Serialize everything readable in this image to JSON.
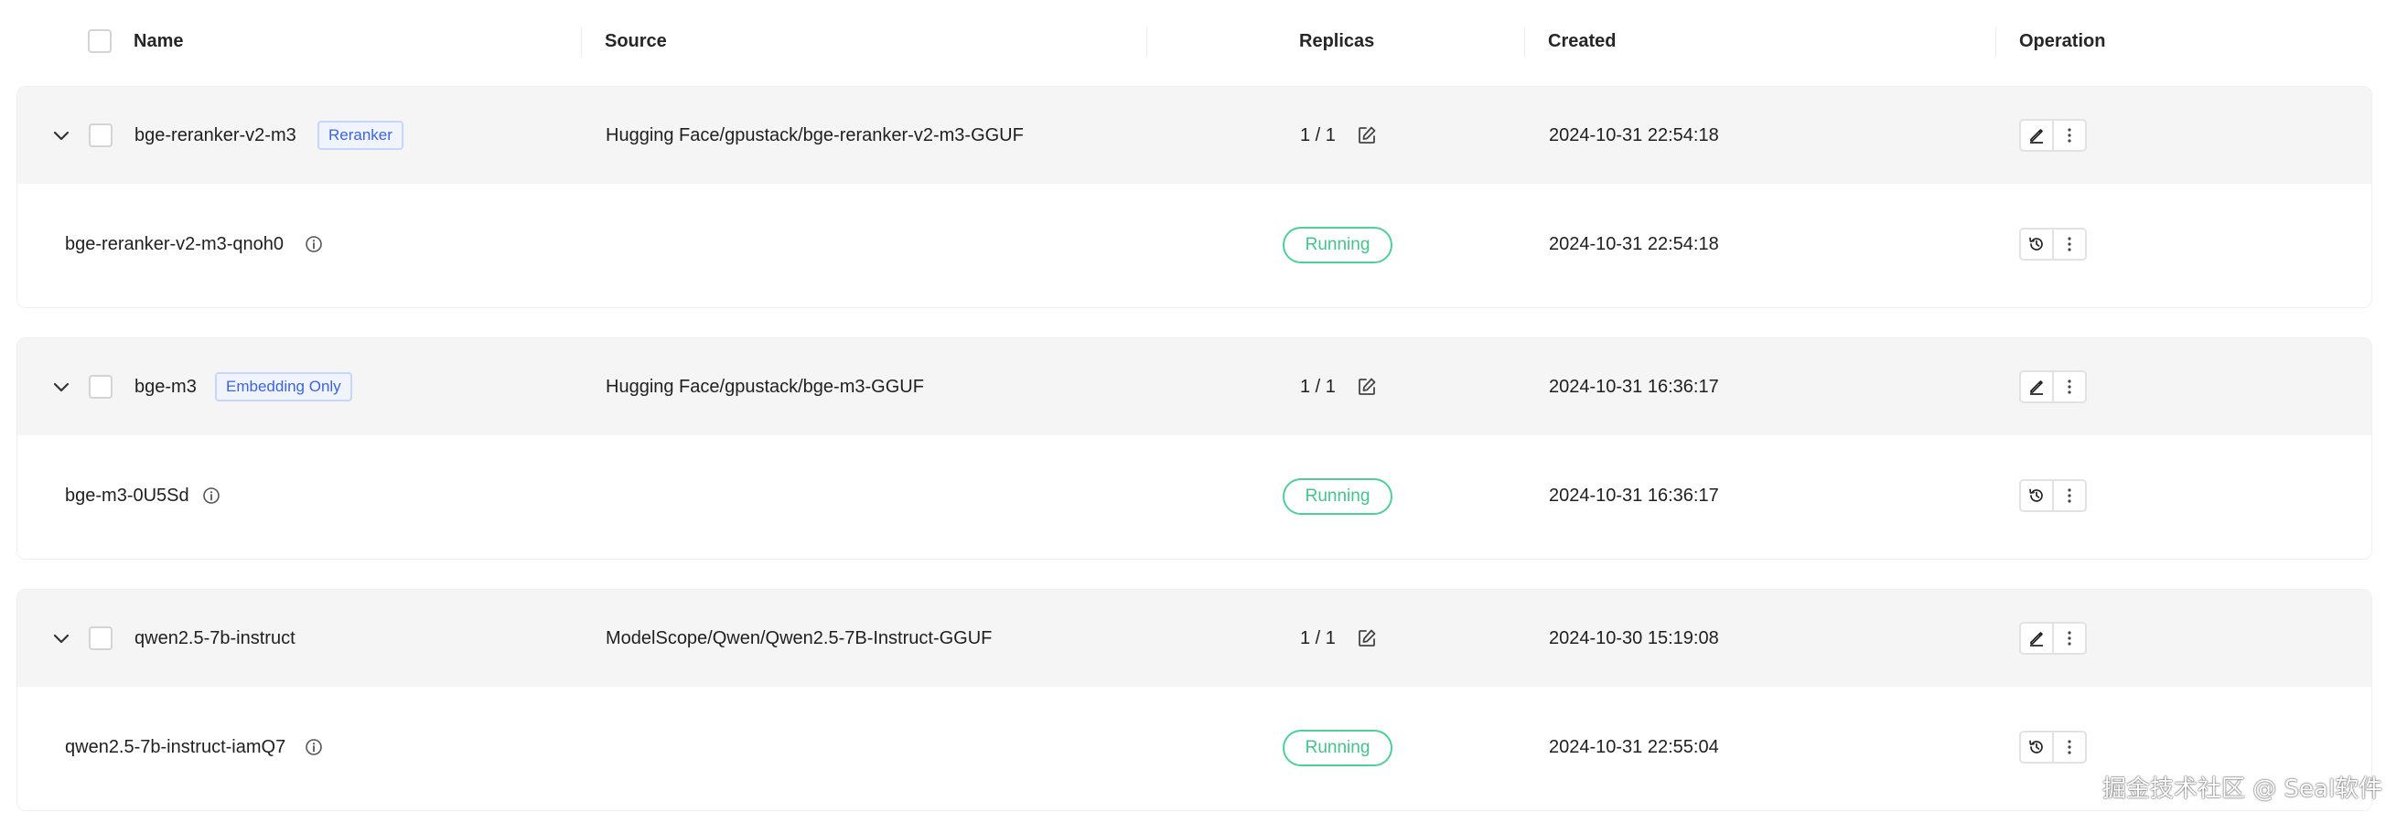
{
  "table": {
    "columns": {
      "name": "Name",
      "source": "Source",
      "replicas": "Replicas",
      "created": "Created",
      "operation": "Operation"
    },
    "rows": [
      {
        "name": "bge-reranker-v2-m3",
        "tag": "Reranker",
        "source": "Hugging Face/gpustack/bge-reranker-v2-m3-GGUF",
        "replicas": "1 / 1",
        "created": "2024-10-31 22:54:18",
        "instance": {
          "name": "bge-reranker-v2-m3-qnoh0",
          "status": "Running",
          "created": "2024-10-31 22:54:18"
        }
      },
      {
        "name": "bge-m3",
        "tag": "Embedding Only",
        "source": "Hugging Face/gpustack/bge-m3-GGUF",
        "replicas": "1 / 1",
        "created": "2024-10-31 16:36:17",
        "instance": {
          "name": "bge-m3-0U5Sd",
          "status": "Running",
          "created": "2024-10-31 16:36:17"
        }
      },
      {
        "name": "qwen2.5-7b-instruct",
        "tag": "",
        "source": "ModelScope/Qwen/Qwen2.5-7B-Instruct-GGUF",
        "replicas": "1 / 1",
        "created": "2024-10-30 15:19:08",
        "instance": {
          "name": "qwen2.5-7b-instruct-iamQ7",
          "status": "Running",
          "created": "2024-10-31 22:55:04"
        }
      }
    ]
  },
  "watermark": "掘金技术社区 @ Seal软件",
  "colors": {
    "running": "#45c28d",
    "tag_text": "#3d63dd",
    "tag_border": "#c9d6fb",
    "row_bg": "#f5f5f5"
  },
  "icons": {
    "expand": "chevron-down-icon",
    "replica_edit": "edit-icon",
    "info": "info-icon",
    "edit": "pencil-icon",
    "more": "more-vertical-icon",
    "logs": "history-icon"
  }
}
